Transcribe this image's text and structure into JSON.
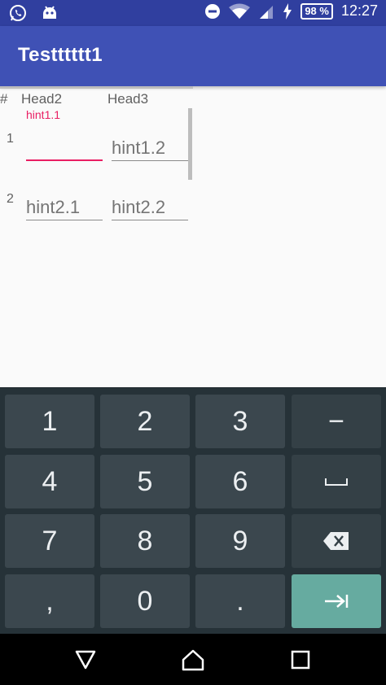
{
  "status_bar": {
    "icons": [
      "whatsapp-icon",
      "android-robot-icon",
      "do-not-disturb-icon",
      "wifi-icon",
      "signal-icon",
      "charging-icon"
    ],
    "battery": "98 %",
    "time": "12:27",
    "color": "#303f9f"
  },
  "app_bar": {
    "title": "Testttttt1",
    "color": "#3f51b5"
  },
  "table": {
    "headers": [
      "#",
      "Head2",
      "Head3"
    ],
    "rows": [
      {
        "num": "1",
        "field1": {
          "label": "hint1.1",
          "value": "",
          "focused": true
        },
        "field2": {
          "value": "hint1.2"
        }
      },
      {
        "num": "2",
        "field1": {
          "value": "hint2.1"
        },
        "field2": {
          "value": "hint2.2"
        }
      }
    ],
    "accent": "#e91e63"
  },
  "keyboard": {
    "rows": [
      [
        "1",
        "2",
        "3",
        "−"
      ],
      [
        "4",
        "5",
        "6",
        "space"
      ],
      [
        "7",
        "8",
        "9",
        "backspace"
      ],
      [
        ",",
        "0",
        ".",
        "next"
      ]
    ],
    "action_color": "#66aba0"
  },
  "nav_bar": {
    "buttons": [
      "back-icon",
      "home-icon",
      "recents-icon"
    ]
  }
}
